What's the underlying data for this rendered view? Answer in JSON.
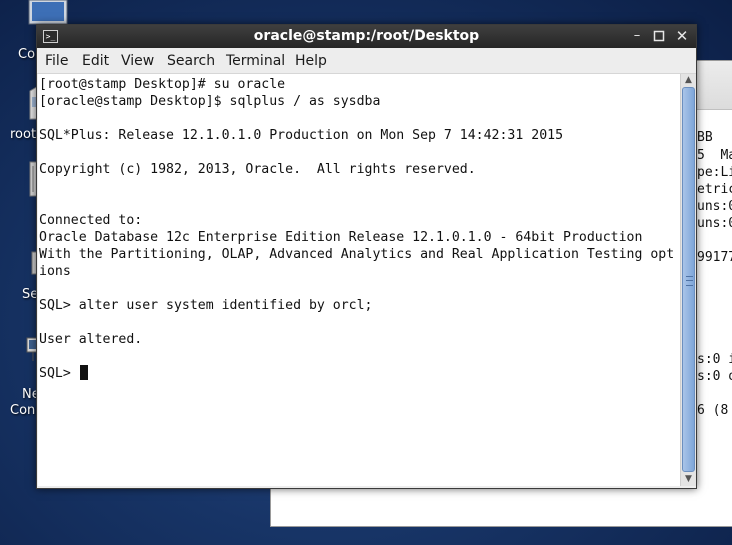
{
  "desktop": {
    "icons": [
      {
        "name": "computer",
        "label": "Co"
      },
      {
        "name": "home",
        "label": "root"
      },
      {
        "name": "trash",
        "label": ""
      },
      {
        "name": "settings",
        "label": "Se"
      },
      {
        "name": "network",
        "label_line1": "Ne",
        "label_line2": "Con"
      }
    ]
  },
  "background_window": {
    "visible_fragments": [
      "BB",
      "5  Ma",
      "pe:Li",
      "etric",
      "uns:0",
      "uns:0",
      "99177",
      "s:0 i",
      "s:0 o",
      "6 (8"
    ]
  },
  "terminal": {
    "title": "oracle@stamp:/root/Desktop",
    "menu": [
      "File",
      "Edit",
      "View",
      "Search",
      "Terminal",
      "Help"
    ],
    "lines": [
      "[root@stamp Desktop]# su oracle",
      "[oracle@stamp Desktop]$ sqlplus / as sysdba",
      "",
      "SQL*Plus: Release 12.1.0.1.0 Production on Mon Sep 7 14:42:31 2015",
      "",
      "Copyright (c) 1982, 2013, Oracle.  All rights reserved.",
      "",
      "",
      "Connected to:",
      "Oracle Database 12c Enterprise Edition Release 12.1.0.1.0 - 64bit Production",
      "With the Partitioning, OLAP, Advanced Analytics and Real Application Testing opt",
      "ions",
      "",
      "SQL> alter user system identified by orcl;",
      "",
      "User altered.",
      "",
      "SQL> "
    ],
    "icons": {
      "title_icon": "terminal-icon",
      "minimize": "minimize-icon",
      "maximize": "maximize-icon",
      "close": "close-icon",
      "scroll_up": "scroll-up-icon",
      "scroll_down": "scroll-down-icon"
    }
  },
  "colors": {
    "desktop_bg": "#173466",
    "titlebar": "#2e2e2e",
    "scroll_thumb": "#8fb2df"
  }
}
